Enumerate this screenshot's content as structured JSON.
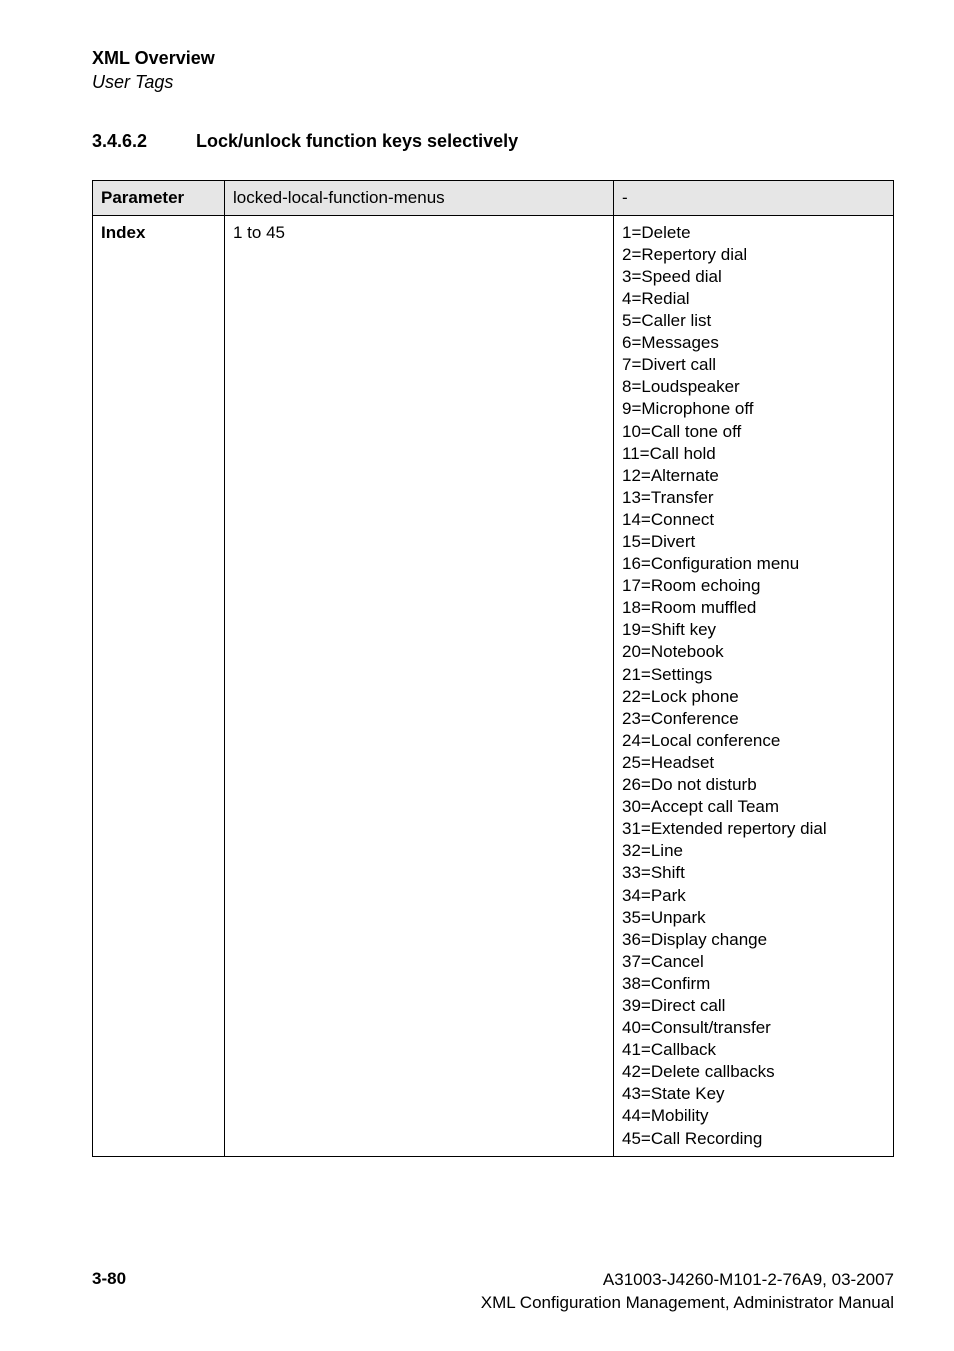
{
  "header": {
    "title": "XML Overview",
    "subtitle": "User Tags"
  },
  "section": {
    "number": "3.4.6.2",
    "title": "Lock/unlock function keys selectively"
  },
  "table": {
    "row1": {
      "label": "Parameter",
      "value": "locked-local-function-menus",
      "extra": "-"
    },
    "row2": {
      "label": "Index",
      "value": "1 to 45",
      "options": [
        "1=Delete",
        "2=Repertory dial",
        "3=Speed dial",
        "4=Redial",
        "5=Caller list",
        "6=Messages",
        "7=Divert call",
        "8=Loudspeaker",
        "9=Microphone off",
        "10=Call tone off",
        "11=Call hold",
        "12=Alternate",
        "13=Transfer",
        "14=Connect",
        "15=Divert",
        "16=Configuration menu",
        "17=Room echoing",
        "18=Room muffled",
        "19=Shift key",
        "20=Notebook",
        "21=Settings",
        "22=Lock phone",
        "23=Conference",
        "24=Local conference",
        "25=Headset",
        "26=Do not disturb",
        "30=Accept call Team",
        "31=Extended repertory dial",
        "32=Line",
        "33=Shift",
        "34=Park",
        "35=Unpark",
        "36=Display change",
        "37=Cancel",
        "38=Confirm",
        "39=Direct call",
        "40=Consult/transfer",
        "41=Callback",
        "42=Delete callbacks",
        "43=State Key",
        "44=Mobility",
        "45=Call Recording"
      ]
    }
  },
  "footer": {
    "page": "3-80",
    "docnum": "A31003-J4260-M101-2-76A9, 03-2007",
    "doctitle": "XML Configuration Management, Administrator Manual"
  }
}
